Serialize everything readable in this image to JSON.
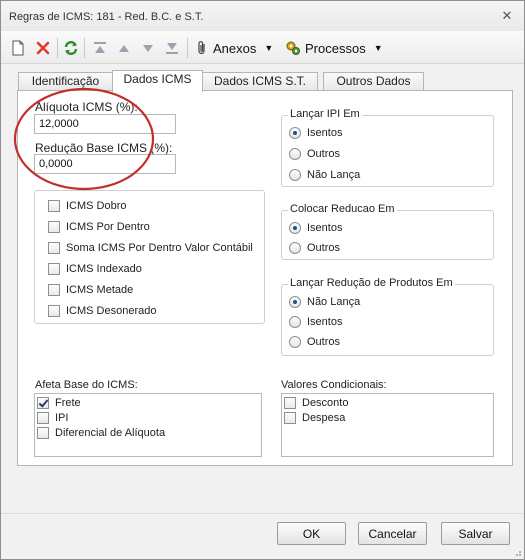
{
  "window": {
    "title": "Regras de ICMS: 181 - Red. B.C. e S.T."
  },
  "toolbar": {
    "anexos_label": "Anexos",
    "processos_label": "Processos"
  },
  "tabs": [
    "Identificação",
    "Dados ICMS",
    "Dados ICMS S.T.",
    "Outros Dados"
  ],
  "active_tab": "Dados ICMS",
  "fields": {
    "aliquota_label": "Alíquota ICMS (%):",
    "aliquota_value": "12,0000",
    "reducao_label": "Redução Base ICMS (%):",
    "reducao_value": "0,0000"
  },
  "icms_options": [
    {
      "label": "ICMS Dobro",
      "checked": false
    },
    {
      "label": "ICMS Por Dentro",
      "checked": false
    },
    {
      "label": "Soma ICMS Por Dentro Valor Contábil",
      "checked": false
    },
    {
      "label": "ICMS Indexado",
      "checked": false
    },
    {
      "label": "ICMS Metade",
      "checked": false
    },
    {
      "label": "ICMS Desonerado",
      "checked": false
    }
  ],
  "lancar_ipi": {
    "title": "Lançar IPI Em",
    "options": [
      "Isentos",
      "Outros",
      "Não Lança"
    ],
    "selected": "Isentos"
  },
  "colocar_reducao": {
    "title": "Colocar Reducao Em",
    "options": [
      "Isentos",
      "Outros"
    ],
    "selected": "Isentos"
  },
  "lancar_reducao_produtos": {
    "title": "Lançar Redução de Produtos Em",
    "options": [
      "Não Lança",
      "Isentos",
      "Outros"
    ],
    "selected": "Não Lança"
  },
  "afeta_base": {
    "title": "Afeta Base do ICMS:",
    "items": [
      {
        "label": "Frete",
        "checked": true
      },
      {
        "label": "IPI",
        "checked": false
      },
      {
        "label": "Diferencial de Alíquota",
        "checked": false
      }
    ]
  },
  "valores_condicionais": {
    "title": "Valores Condicionais:",
    "items": [
      {
        "label": "Desconto",
        "checked": false
      },
      {
        "label": "Despesa",
        "checked": false
      }
    ]
  },
  "buttons": {
    "ok": "OK",
    "cancel": "Cancelar",
    "save": "Salvar"
  },
  "colors": {
    "annotation_circle": "#c0302b",
    "delete_icon": "#e03a2a",
    "refresh_icon": "#2e8b2e"
  }
}
